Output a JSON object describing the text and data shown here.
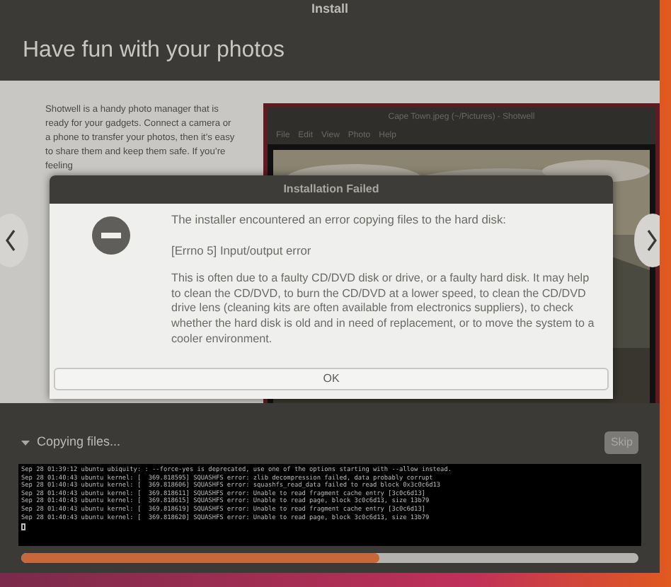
{
  "window": {
    "title": "Install"
  },
  "slide": {
    "heading": "Have fun with your photos",
    "text": "Shotwell is a handy photo manager that is ready for your gadgets. Connect a camera or a phone to transfer your photos, then it’s easy to share them and keep them safe. If you’re feeling",
    "screenshot": {
      "title": "Cape Town.jpeg (~/Pictures) - Shotwell",
      "menu": [
        "File",
        "Edit",
        "View",
        "Photo",
        "Help"
      ]
    }
  },
  "dialog": {
    "title": "Installation Failed",
    "message": "The installer encountered an error copying files to the hard disk:",
    "error": "[Errno 5] Input/output error",
    "details": "This is often due to a faulty CD/DVD disk or drive, or a faulty hard disk. It may help to clean the CD/DVD, to burn the CD/DVD at a lower speed, to clean the CD/DVD drive lens (cleaning kits are often available from electronics suppliers), to check whether the hard disk is old and in need of replacement, or to move the system to a cooler environment.",
    "button": "OK"
  },
  "progress": {
    "label": "Copying files...",
    "expanded": true,
    "skip": {
      "label": "Skip",
      "disabled": true
    },
    "level": 0.58,
    "log": [
      "Sep 28 01:39:12 ubuntu ubiquity: : --force-yes is deprecated, use one of the options starting with --allow instead.",
      "Sep 28 01:40:43 ubuntu kernel: [  369.818595] SQUASHFS error: zlib decompression failed, data probably corrupt",
      "Sep 28 01:40:43 ubuntu kernel: [  369.818606] SQUASHFS error: squashfs_read_data failed to read block 0x3c0c6d13",
      "Sep 28 01:40:43 ubuntu kernel: [  369.818611] SQUASHFS error: Unable to read fragment cache entry [3c0c6d13]",
      "Sep 28 01:40:43 ubuntu kernel: [  369.818615] SQUASHFS error: Unable to read page, block 3c0c6d13, size 13b79",
      "Sep 28 01:40:43 ubuntu kernel: [  369.818619] SQUASHFS error: Unable to read fragment cache entry [3c0c6d13]",
      "Sep 28 01:40:43 ubuntu kernel: [  369.818620] SQUASHFS error: Unable to read page, block 3c0c6d13, size 13b79"
    ]
  }
}
